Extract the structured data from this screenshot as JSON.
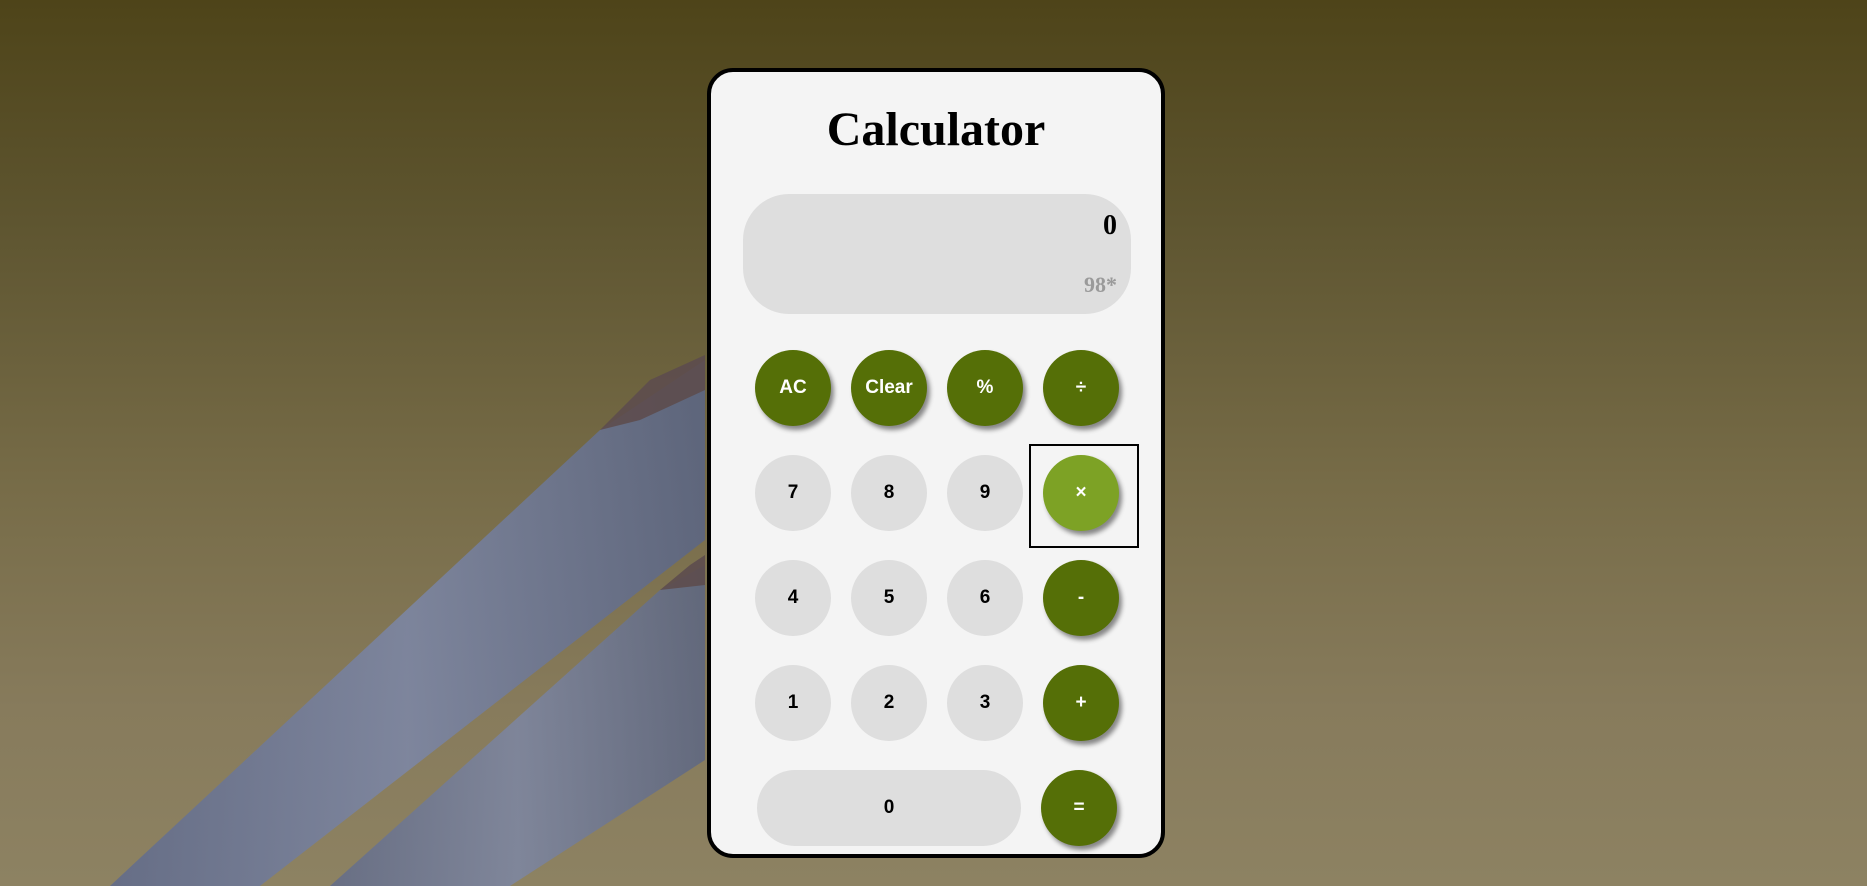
{
  "calculator": {
    "title": "Calculator",
    "display": {
      "result": "0",
      "history": "98*"
    },
    "buttons": {
      "ac": "AC",
      "clear": "Clear",
      "percent": "%",
      "divide": "÷",
      "seven": "7",
      "eight": "8",
      "nine": "9",
      "multiply": "×",
      "four": "4",
      "five": "5",
      "six": "6",
      "minus": "-",
      "one": "1",
      "two": "2",
      "three": "3",
      "plus": "+",
      "zero": "0",
      "equals": "="
    },
    "active_operator": "multiply"
  },
  "colors": {
    "operator": "#556f07",
    "operator_active": "#7da225",
    "number": "#dedede",
    "panel": "#f4f4f4"
  }
}
